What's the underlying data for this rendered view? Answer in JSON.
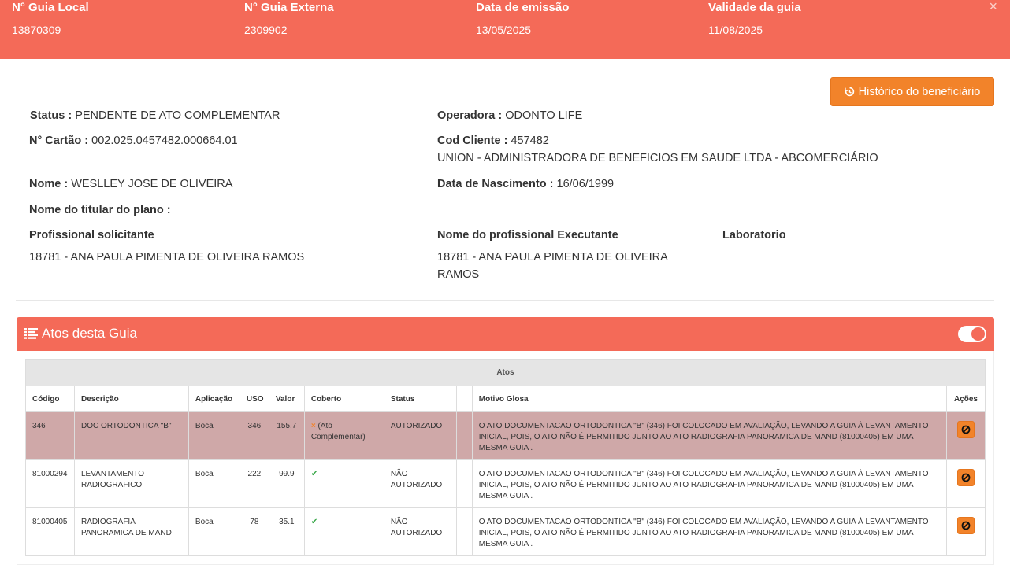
{
  "header": {
    "fields": [
      {
        "label": "N° Guia Local",
        "value": "13870309"
      },
      {
        "label": "N° Guia Externa",
        "value": "2309902"
      },
      {
        "label": "Data de emissão",
        "value": "13/05/2025"
      },
      {
        "label": "Validade da guia",
        "value": "11/08/2025"
      }
    ],
    "close_symbol": "×"
  },
  "history_button": {
    "label": "Histórico do beneficiário",
    "icon": "history-icon"
  },
  "details": {
    "status_label": "Status :",
    "status_value": "PENDENTE DE ATO COMPLEMENTAR",
    "card_label": "N° Cartão :",
    "card_value": "002.025.0457482.000664.01",
    "name_label": "Nome :",
    "name_value": "WESLLEY JOSE DE OLIVEIRA",
    "holder_label": "Nome do titular do plano :",
    "requester_label": "Profissional solicitante",
    "requester_value": "18781 - ANA PAULA PIMENTA DE OLIVEIRA RAMOS",
    "operator_label": "Operadora :",
    "operator_value": "ODONTO LIFE",
    "client_code_label": "Cod Cliente :",
    "client_code_value": "457482",
    "client_company": "UNION - ADMINISTRADORA DE BENEFICIOS EM SAUDE LTDA - ABCOMERCIÁRIO",
    "birth_label": "Data de Nascimento :",
    "birth_value": "16/06/1999",
    "executor_label": "Nome do profissional Executante",
    "executor_value_line1": "18781 - ANA PAULA PIMENTA DE OLIVEIRA",
    "executor_value_line2": "RAMOS",
    "lab_label": "Laboratorio"
  },
  "panel": {
    "title": "Atos desta Guia",
    "icon": "list-icon",
    "toggle_on": true
  },
  "table": {
    "group_header": "Atos",
    "columns": [
      "Código",
      "Descrição",
      "Aplicação",
      "USO",
      "Valor",
      "Coberto",
      "Status",
      "",
      "Motivo Glosa",
      "Ações"
    ],
    "rows": [
      {
        "code": "346",
        "description": "DOC ORTODONTICA \"B\"",
        "application": "Boca",
        "uso": "346",
        "value": "155.7",
        "covered_icon": "×",
        "covered_text": "(Ato Complementar)",
        "status": "AUTORIZADO",
        "reason": "O ATO DOCUMENTACAO ORTODONTICA \"B\" (346) FOI COLOCADO EM AVALIAÇÃO, LEVANDO A GUIA À LEVANTAMENTO INICIAL, POIS, O ATO NÃO É PERMITIDO JUNTO AO ATO RADIOGRAFIA PANORAMICA DE MAND (81000405) EM UMA MESMA GUIA .",
        "highlighted": true
      },
      {
        "code": "81000294",
        "description": "LEVANTAMENTO RADIOGRAFICO",
        "application": "Boca",
        "uso": "222",
        "value": "99.9",
        "covered_icon": "✔",
        "covered_text": "",
        "status": "NÃO AUTORIZADO",
        "reason": "O ATO DOCUMENTACAO ORTODONTICA \"B\" (346) FOI COLOCADO EM AVALIAÇÃO, LEVANDO A GUIA À LEVANTAMENTO INICIAL, POIS, O ATO NÃO É PERMITIDO JUNTO AO ATO RADIOGRAFIA PANORAMICA DE MAND (81000405) EM UMA MESMA GUIA .",
        "highlighted": false
      },
      {
        "code": "81000405",
        "description": "RADIOGRAFIA PANORAMICA DE MAND",
        "application": "Boca",
        "uso": "78",
        "value": "35.1",
        "covered_icon": "✔",
        "covered_text": "",
        "status": "NÃO AUTORIZADO",
        "reason": "O ATO DOCUMENTACAO ORTODONTICA \"B\" (346) FOI COLOCADO EM AVALIAÇÃO, LEVANDO A GUIA À LEVANTAMENTO INICIAL, POIS, O ATO NÃO É PERMITIDO JUNTO AO ATO RADIOGRAFIA PANORAMICA DE MAND (81000405) EM UMA MESMA GUIA .",
        "highlighted": false
      }
    ]
  },
  "colors": {
    "header_bg": "#f46a58",
    "button_orange": "#f2832a",
    "highlight_row": "#cfa8a8",
    "check_green": "#3aa84a"
  }
}
